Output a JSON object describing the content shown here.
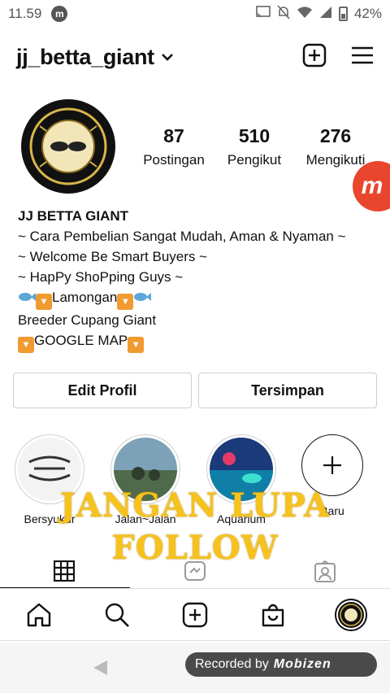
{
  "status": {
    "time": "11.59",
    "battery": "42%"
  },
  "header": {
    "username": "jj_betta_giant"
  },
  "stats": [
    {
      "value": "87",
      "label": "Postingan"
    },
    {
      "value": "510",
      "label": "Pengikut"
    },
    {
      "value": "276",
      "label": "Mengikuti"
    }
  ],
  "bio": {
    "name": "JJ BETTA GIANT",
    "line1": "~ Cara Pembelian Sangat Mudah, Aman & Nyaman ~",
    "line2": "~ Welcome Be Smart Buyers ~",
    "line3": "~ HapPy ShoPping Guys ~",
    "line4": "Lamongan",
    "line5": "Breeder Cupang Giant",
    "line6": "GOOGLE MAP"
  },
  "buttons": {
    "edit": "Edit Profil",
    "saved": "Tersimpan"
  },
  "highlights": [
    {
      "label": "Bersyukur"
    },
    {
      "label": "Jalan~Jalan"
    },
    {
      "label": "Aquarium"
    },
    {
      "label": "Baru"
    }
  ],
  "overlay": {
    "line1": "JANGAN LUPA",
    "line2": "FOLLOW"
  },
  "recorder": {
    "text": "Recorded by",
    "brand": "Mobizen"
  },
  "colors": {
    "accent": "#f6c21c",
    "fab": "#e8462d"
  }
}
